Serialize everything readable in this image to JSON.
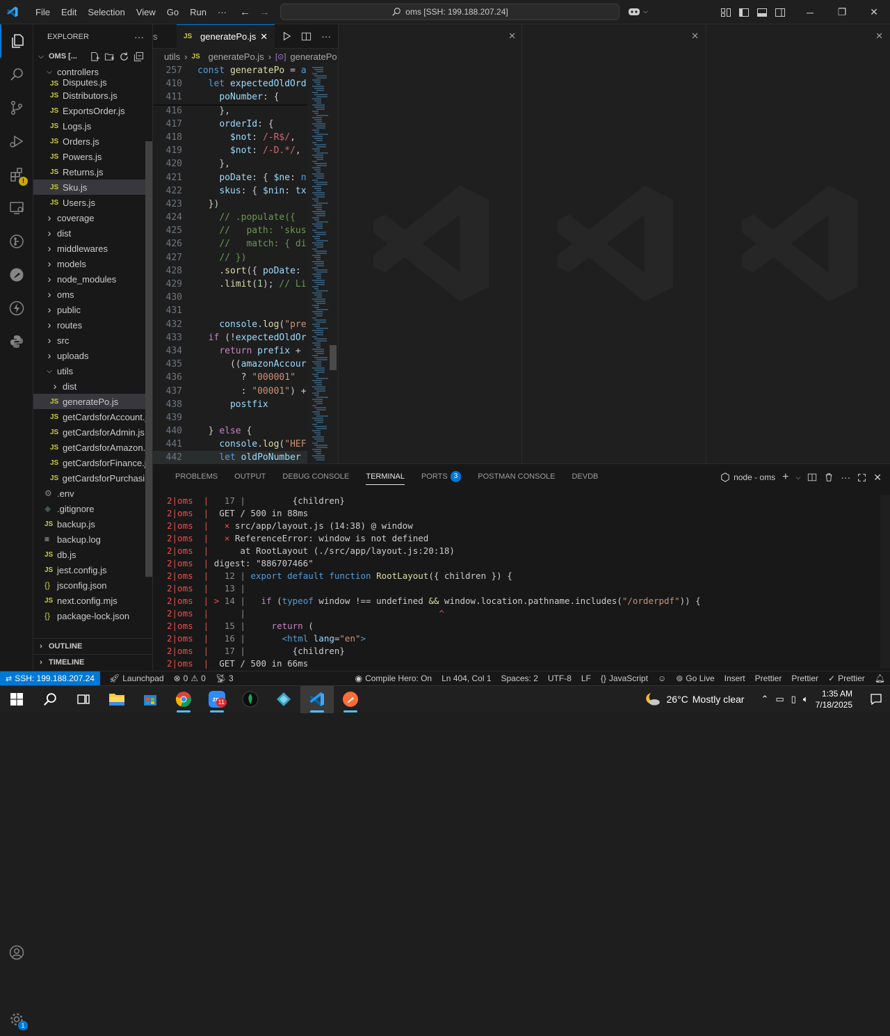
{
  "titlebar": {
    "menu": [
      "File",
      "Edit",
      "Selection",
      "View",
      "Go",
      "Run",
      "···"
    ],
    "command_center": "oms [SSH: 199.188.207.24]"
  },
  "sidebar": {
    "header": "EXPLORER",
    "root": "OMS [...",
    "rows": [
      {
        "type": "folder-open",
        "label": "controllers",
        "indent": 1
      },
      {
        "type": "js",
        "label": "Disputes.js",
        "indent": 2,
        "partial": true
      },
      {
        "type": "js",
        "label": "Distributors.js",
        "indent": 2
      },
      {
        "type": "js",
        "label": "ExportsOrder.js",
        "indent": 2
      },
      {
        "type": "js",
        "label": "Logs.js",
        "indent": 2
      },
      {
        "type": "js",
        "label": "Orders.js",
        "indent": 2
      },
      {
        "type": "js",
        "label": "Powers.js",
        "indent": 2
      },
      {
        "type": "js",
        "label": "Returns.js",
        "indent": 2
      },
      {
        "type": "js",
        "label": "Sku.js",
        "indent": 2,
        "hover": true
      },
      {
        "type": "js",
        "label": "Users.js",
        "indent": 2
      },
      {
        "type": "folder",
        "label": "coverage",
        "indent": 1
      },
      {
        "type": "folder",
        "label": "dist",
        "indent": 1
      },
      {
        "type": "folder",
        "label": "middlewares",
        "indent": 1
      },
      {
        "type": "folder",
        "label": "models",
        "indent": 1
      },
      {
        "type": "folder",
        "label": "node_modules",
        "indent": 1
      },
      {
        "type": "folder",
        "label": "oms",
        "indent": 1
      },
      {
        "type": "folder",
        "label": "public",
        "indent": 1
      },
      {
        "type": "folder",
        "label": "routes",
        "indent": 1
      },
      {
        "type": "folder",
        "label": "src",
        "indent": 1
      },
      {
        "type": "folder",
        "label": "uploads",
        "indent": 1
      },
      {
        "type": "folder-open",
        "label": "utils",
        "indent": 1
      },
      {
        "type": "folder",
        "label": "dist",
        "indent": 2
      },
      {
        "type": "js",
        "label": "generatePo.js",
        "indent": 2,
        "selected": true
      },
      {
        "type": "js",
        "label": "getCardsforAccount.js",
        "indent": 2
      },
      {
        "type": "js",
        "label": "getCardsforAdmin.js",
        "indent": 2
      },
      {
        "type": "js",
        "label": "getCardsforAmazon.js",
        "indent": 2
      },
      {
        "type": "js",
        "label": "getCardsforFinance.js",
        "indent": 2
      },
      {
        "type": "js",
        "label": "getCardsforPurchasi...",
        "indent": 2
      },
      {
        "type": "gear",
        "label": ".env",
        "indent": 1
      },
      {
        "type": "git",
        "label": ".gitignore",
        "indent": 1
      },
      {
        "type": "js",
        "label": "backup.js",
        "indent": 1
      },
      {
        "type": "log",
        "label": "backup.log",
        "indent": 1
      },
      {
        "type": "js",
        "label": "db.js",
        "indent": 1
      },
      {
        "type": "js",
        "label": "jest.config.js",
        "indent": 1
      },
      {
        "type": "json",
        "label": "jsconfig.json",
        "indent": 1
      },
      {
        "type": "js",
        "label": "next.config.mjs",
        "indent": 1
      },
      {
        "type": "json",
        "label": "package-lock.json",
        "indent": 1
      },
      {
        "type": "json",
        "label": "package.json",
        "indent": 1,
        "partial": true
      }
    ],
    "outline": "OUTLINE",
    "timeline": "TIMELINE"
  },
  "editor": {
    "prev_tab_fragment": "s",
    "active_tab": "generatePo.js",
    "breadcrumbs": [
      "utils",
      "generatePo.js",
      "generatePo"
    ],
    "lines": [
      {
        "n": "257",
        "html": "<span class='kw'>const</span> <span class='fn'>generatePo</span> = <span class='kw'>a</span>"
      },
      {
        "n": "410",
        "html": "  <span class='kw'>let</span> <span class='var'>expectedOldOrd</span>"
      },
      {
        "n": "411",
        "html": "    <span class='var'>poNumber</span>: {"
      },
      {
        "n": "416",
        "html": "    },"
      },
      {
        "n": "417",
        "html": "    <span class='var'>orderId</span>: {"
      },
      {
        "n": "418",
        "html": "      <span class='var'>$not</span>: <span class='rx'>/-R$/</span>,"
      },
      {
        "n": "419",
        "html": "      <span class='var'>$not</span>: <span class='rx'>/-D.*/</span>,"
      },
      {
        "n": "420",
        "html": "    },"
      },
      {
        "n": "421",
        "html": "    <span class='var'>poDate</span>: { <span class='var'>$ne</span>: <span class='kw'>n</span>"
      },
      {
        "n": "422",
        "html": "    <span class='var'>skus</span>: { <span class='var'>$nin</span>: <span class='var'>tx</span>"
      },
      {
        "n": "423",
        "html": "  })"
      },
      {
        "n": "424",
        "html": "    <span class='cm'>// .populate({</span>"
      },
      {
        "n": "425",
        "html": "    <span class='cm'>//   path: 'skus</span>"
      },
      {
        "n": "426",
        "html": "    <span class='cm'>//   match: { di</span>"
      },
      {
        "n": "427",
        "html": "    <span class='cm'>// })</span>"
      },
      {
        "n": "428",
        "html": "    .<span class='fn'>sort</span>({ <span class='var'>poDate</span>:"
      },
      {
        "n": "429",
        "html": "    .<span class='fn'>limit</span>(<span class='num'>1</span>); <span class='cm'>// Li</span>"
      },
      {
        "n": "430",
        "html": ""
      },
      {
        "n": "431",
        "html": ""
      },
      {
        "n": "432",
        "html": "    <span class='var'>console</span>.<span class='fn'>log</span>(<span class='str'>\"pre</span>"
      },
      {
        "n": "433",
        "html": "  <span class='kw2'>if</span> (!<span class='var'>expectedOldOr</span>"
      },
      {
        "n": "434",
        "html": "    <span class='kw2'>return</span> <span class='var'>prefix</span> +"
      },
      {
        "n": "435",
        "html": "      ((<span class='var'>amazonAccour</span>"
      },
      {
        "n": "436",
        "html": "        ? <span class='str'>\"000001\"</span>"
      },
      {
        "n": "437",
        "html": "        : <span class='str'>\"00001\"</span>) +"
      },
      {
        "n": "438",
        "html": "      <span class='var'>postfix</span>"
      },
      {
        "n": "439",
        "html": ""
      },
      {
        "n": "440",
        "html": "  } <span class='kw2'>else</span> {"
      },
      {
        "n": "441",
        "html": "    <span class='var'>console</span>.<span class='fn'>log</span>(<span class='str'>\"HEF</span>"
      },
      {
        "n": "442",
        "html": "    <span class='kw'>let</span> <span class='var'>oldPoNumber</span>"
      }
    ]
  },
  "panel": {
    "tabs": [
      "PROBLEMS",
      "OUTPUT",
      "DEBUG CONSOLE",
      "TERMINAL",
      "PORTS",
      "POSTMAN CONSOLE",
      "DEVDB"
    ],
    "active_tab": "TERMINAL",
    "ports_badge": "3",
    "terminal_name": "node - oms",
    "terminal_lines": [
      {
        "p": "2|oms  | ",
        "html": "  <span class='tgrey'>17 |</span>         {children}"
      },
      {
        "p": "2|oms  | ",
        "html": " GET / 500 in 88ms"
      },
      {
        "p": "2|oms  | ",
        "html": "  <span class='red'>⨯</span> src/app/layout.js (14:38) @ window"
      },
      {
        "p": "2|oms  | ",
        "html": "  <span class='red'>⨯</span> ReferenceError: window is not defined"
      },
      {
        "p": "2|oms  | ",
        "html": "     at RootLayout (./src/app/layout.js:20:18)"
      },
      {
        "p": "2|oms  | ",
        "html": "digest: \"886707466\""
      },
      {
        "p": "2|oms  | ",
        "html": "  <span class='tgrey'>12 |</span> <span class='kw'>export default function</span> <span class='fn'>RootLayout</span>({ children }) {"
      },
      {
        "p": "2|oms  | ",
        "html": "  <span class='tgrey'>13 |</span>"
      },
      {
        "p": "2|oms  | ",
        "html": "<span class='red'>&gt;</span> <span class='tgrey'>14 |</span>   <span class='kw2'>if</span> (<span class='kw'>typeof</span> window !== undefined <span class='fn'>&amp;&amp;</span> window.location.pathname.includes(<span class='str'>\"/orderpdf\"</span>)) {"
      },
      {
        "p": "2|oms  | ",
        "html": "     <span class='tgrey'>|</span>                                     <span class='red'>^</span>"
      },
      {
        "p": "2|oms  | ",
        "html": "  <span class='tgrey'>15 |</span>     <span class='kw2'>return</span> ("
      },
      {
        "p": "2|oms  | ",
        "html": "  <span class='tgrey'>16 |</span>       <span class='kw'>&lt;html</span> <span class='var'>lang</span>=<span class='str'>\"en\"</span><span class='kw'>&gt;</span>"
      },
      {
        "p": "2|oms  | ",
        "html": "  <span class='tgrey'>17 |</span>         {children}"
      },
      {
        "p": "2|oms  | ",
        "html": " GET / 500 in 66ms"
      }
    ]
  },
  "statusbar": {
    "remote": "SSH: 199.188.207.24",
    "launchpad": "Launchpad",
    "errors": "0",
    "warnings": "0",
    "ports": "3",
    "compile_hero": "Compile Hero: On",
    "position": "Ln 404, Col 1",
    "spaces": "Spaces: 2",
    "encoding": "UTF-8",
    "eol": "LF",
    "language": "JavaScript",
    "go_live": "Go Live",
    "insert": "Insert",
    "prettier1": "Prettier",
    "prettier2": "Prettier",
    "prettier3": "Prettier"
  },
  "taskbar": {
    "weather_temp": "26°C",
    "weather_desc": "Mostly clear",
    "time": "1:35 AM",
    "date": "7/18/2025",
    "zoom_badge": "11"
  },
  "colors": {
    "accent": "#0078d4",
    "js_icon": "#cbcb41",
    "error_red": "#f14c4c"
  }
}
